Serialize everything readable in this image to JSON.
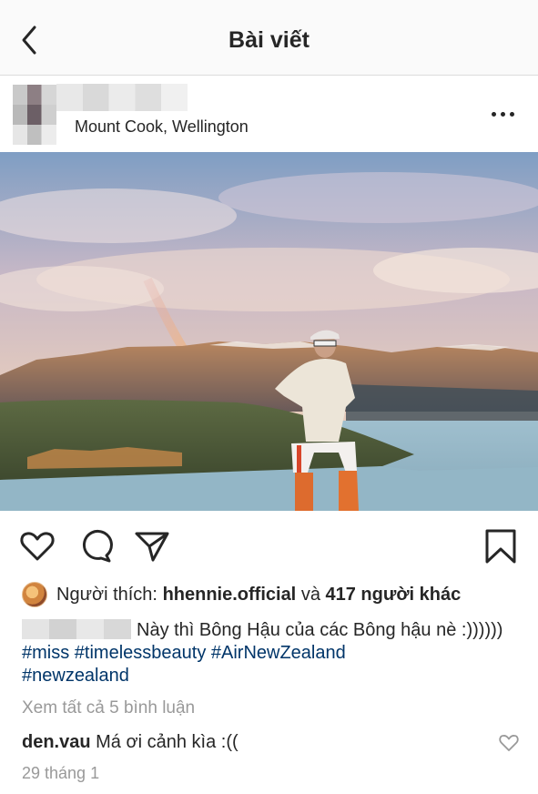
{
  "navbar": {
    "title": "Bài viết"
  },
  "post": {
    "location": "Mount Cook, Wellington",
    "likes": {
      "prefix": "Người thích:",
      "user": "hhennie.official",
      "conj": "và",
      "others": "417 người khác"
    },
    "caption": {
      "text": "Này thì Bông Hậu của các Bông hậu nè :))))))",
      "hashtags": [
        "#miss",
        "#timelessbeauty",
        "#AirNewZealand",
        "#newzealand"
      ]
    },
    "view_all_comments": "Xem tất cả 5 bình luận",
    "comment": {
      "user": "den.vau",
      "text": "Má ơi cảnh kìa :(("
    },
    "date": "29 tháng 1"
  },
  "icons": {
    "back": "chevron-left-icon",
    "more": "more-horizontal-icon",
    "like": "heart-icon",
    "comment": "comment-bubble-icon",
    "share": "paper-plane-icon",
    "save": "bookmark-icon"
  },
  "colors": {
    "hashtag": "#003569",
    "muted": "#999999",
    "text": "#262626"
  }
}
